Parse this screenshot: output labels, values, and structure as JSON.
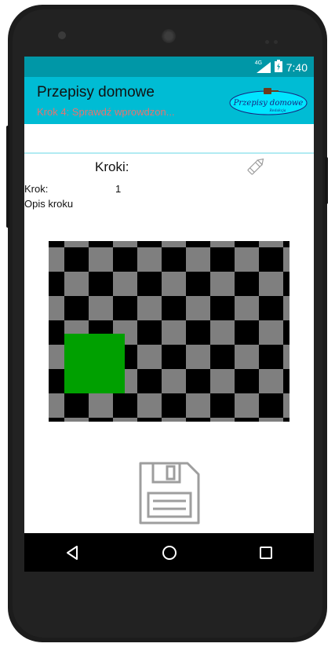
{
  "status_bar": {
    "network": "4G",
    "time": "7:40"
  },
  "app_bar": {
    "title": "Przepisy domowe",
    "subtitle": "Krok 4: Sprawdź wprowdzon...",
    "logo_text": "Przepisy domowe",
    "logo_subtext": "Redakcja"
  },
  "steps": {
    "heading": "Kroki:",
    "step_label": "Krok:",
    "step_number": "1",
    "description": "Opis kroku"
  },
  "icons": {
    "edit": "pencil-icon",
    "save": "floppy-disk-icon",
    "back": "nav-back-icon",
    "home": "nav-home-icon",
    "recents": "nav-recents-icon"
  },
  "colors": {
    "status_bar": "#0097a7",
    "app_bar": "#00bcd4",
    "subtitle": "#e8736f",
    "checker_dark": "#000000",
    "checker_light": "#7f7f7f",
    "placeholder_square": "#00a000"
  }
}
